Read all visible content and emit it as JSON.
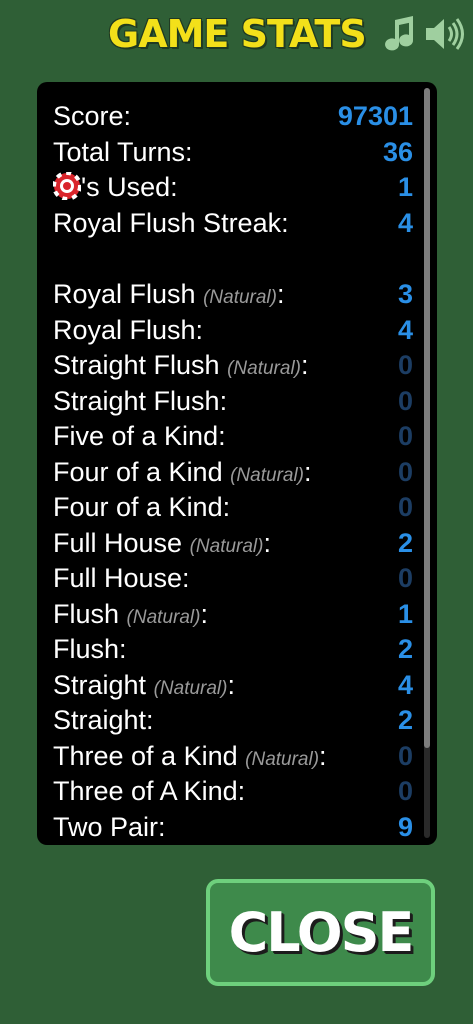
{
  "header": {
    "title": "GAME STATS",
    "music_icon": "music-note",
    "sound_icon": "speaker-volume"
  },
  "colors": {
    "background": "#2f5f36",
    "title": "#f3e01a",
    "value": "#2a8fe6",
    "value_zero": "#1c3d63",
    "close_border": "#6ed07d"
  },
  "stats": {
    "score": {
      "label": "Score:",
      "value": "97301"
    },
    "total_turns": {
      "label": "Total Turns:",
      "value": "36"
    },
    "chips_used": {
      "icon": "poker-chip",
      "label": "'s Used:",
      "value": "1"
    },
    "royal_streak": {
      "label": "Royal Flush Streak:",
      "value": "4"
    }
  },
  "hands": [
    {
      "label": "Royal Flush",
      "note": "(Natural)",
      "value": "3"
    },
    {
      "label": "Royal Flush:",
      "note": "",
      "value": "4"
    },
    {
      "label": "Straight Flush",
      "note": "(Natural)",
      "value": "0"
    },
    {
      "label": "Straight Flush:",
      "note": "",
      "value": "0"
    },
    {
      "label": "Five of a Kind:",
      "note": "",
      "value": "0"
    },
    {
      "label": "Four of a Kind",
      "note": "(Natural)",
      "value": "0"
    },
    {
      "label": "Four of a Kind:",
      "note": "",
      "value": "0"
    },
    {
      "label": "Full House",
      "note": "(Natural)",
      "value": "2"
    },
    {
      "label": "Full House:",
      "note": "",
      "value": "0"
    },
    {
      "label": "Flush",
      "note": "(Natural)",
      "value": "1"
    },
    {
      "label": "Flush:",
      "note": "",
      "value": "2"
    },
    {
      "label": "Straight",
      "note": "(Natural)",
      "value": "4"
    },
    {
      "label": "Straight:",
      "note": "",
      "value": "2"
    },
    {
      "label": "Three of a Kind",
      "note": "(Natural)",
      "value": "0"
    },
    {
      "label": "Three of A Kind:",
      "note": "",
      "value": "0"
    },
    {
      "label": "Two Pair:",
      "note": "",
      "value": "9"
    }
  ],
  "close_button": {
    "label": "CLOSE"
  }
}
